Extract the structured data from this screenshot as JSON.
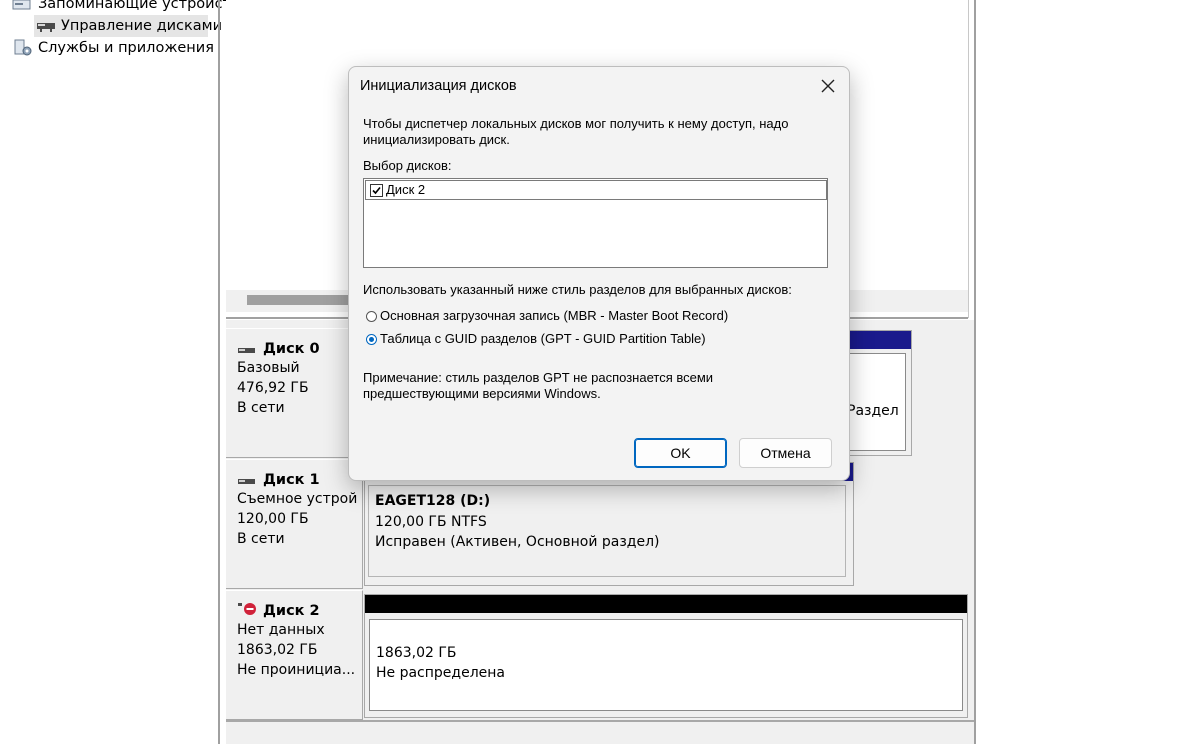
{
  "tree": {
    "storage_label": "Запоминающие устройств",
    "disk_mgmt_label": "Управление дисками",
    "services_label": "Службы и приложения"
  },
  "disks": [
    {
      "title": "Диск 0",
      "type": "Базовый",
      "size": "476,92 ГБ",
      "status": "В сети",
      "partition_fragment": "Раздел"
    },
    {
      "title": "Диск 1",
      "type": "Съемное устрой",
      "size": "120,00 ГБ",
      "status": "В сети",
      "partition": {
        "name": "EAGET128  (D:)",
        "size_fs": "120,00 ГБ NTFS",
        "health": "Исправен (Активен, Основной раздел)"
      }
    },
    {
      "title": "Диск 2",
      "type": "Нет данных",
      "size": "1863,02 ГБ",
      "status": "Не проинициа...",
      "partition": {
        "size": "1863,02 ГБ",
        "state": "Не распределена"
      }
    }
  ],
  "dialog": {
    "title": "Инициализация дисков",
    "intro_line1": "Чтобы диспетчер локальных дисков мог получить к нему доступ, надо",
    "intro_line2": "инициализировать диск.",
    "select_label": "Выбор дисков:",
    "disk_item": "Диск 2",
    "disk_item_checked": true,
    "style_label": "Использовать указанный ниже стиль разделов для выбранных дисков:",
    "option_mbr": "Основная загрузочная запись (MBR - Master Boot Record)",
    "option_gpt": "Таблица с GUID разделов (GPT - GUID Partition Table)",
    "selected_option": "gpt",
    "note_line1": "Примечание: стиль разделов GPT не распознается всеми",
    "note_line2": "предшествующими версиями Windows.",
    "ok_label": "OK",
    "cancel_label": "Отмена"
  },
  "colors": {
    "partition_bar_blue": "#1a1a8c",
    "unallocated_bar": "#000000",
    "accent": "#0067c0"
  }
}
